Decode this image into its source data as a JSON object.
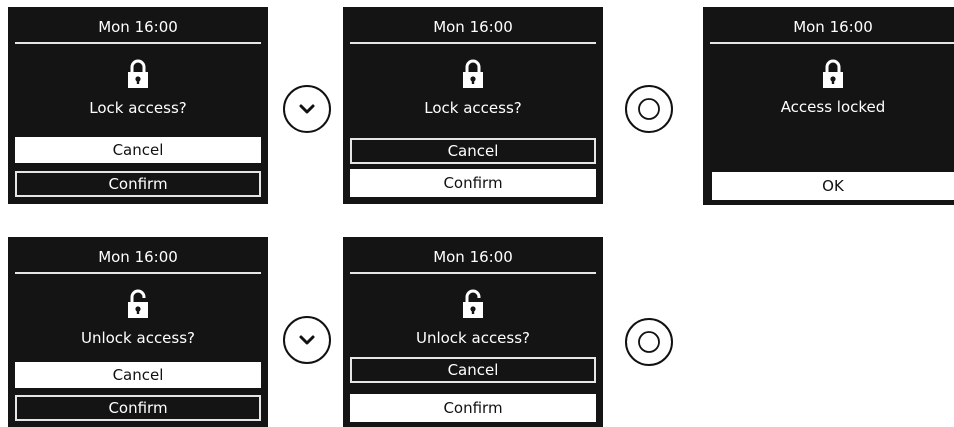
{
  "screens": [
    {
      "time": "Mon 16:00",
      "message": "Lock access?",
      "button1": "Cancel",
      "button2": "Confirm",
      "icon": "lock-closed-icon"
    },
    {
      "time": "Mon 16:00",
      "message": "Lock access?",
      "button1": "Cancel",
      "button2": "Confirm",
      "icon": "lock-closed-icon"
    },
    {
      "time": "Mon 16:00",
      "message": "Access locked",
      "button1": "OK",
      "icon": "lock-closed-icon"
    },
    {
      "time": "Mon 16:00",
      "message": "Unlock access?",
      "button1": "Cancel",
      "button2": "Confirm",
      "icon": "lock-open-icon"
    },
    {
      "time": "Mon 16:00",
      "message": "Unlock access?",
      "button1": "Cancel",
      "button2": "Confirm",
      "icon": "lock-open-icon"
    }
  ],
  "controls": [
    {
      "icon": "chevron-down-icon"
    },
    {
      "icon": "confirm-circle-icon"
    },
    {
      "icon": "chevron-down-icon"
    },
    {
      "icon": "confirm-circle-icon"
    }
  ],
  "colors": {
    "screen_bg": "#141414",
    "text": "#ffffff",
    "selected_bg": "#ffffff"
  }
}
